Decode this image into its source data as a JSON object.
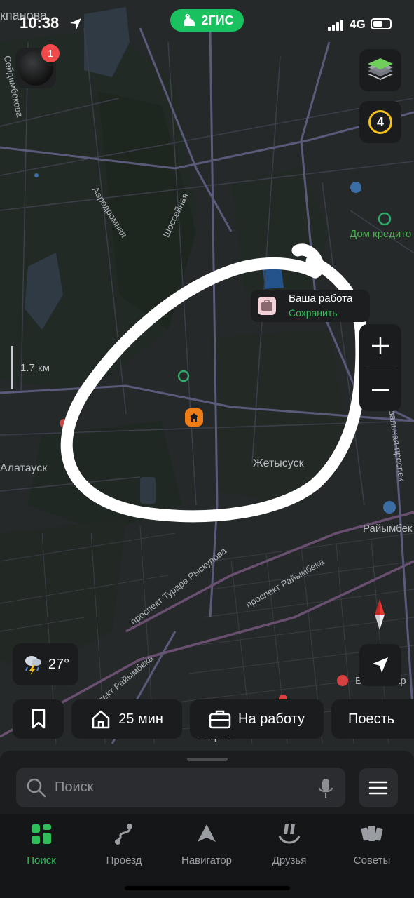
{
  "status": {
    "time": "10:38",
    "network": "4G"
  },
  "brand": {
    "name": "2ГИС"
  },
  "avatar": {
    "badge_count": "1"
  },
  "controls": {
    "traffic_level": "4",
    "zoom_in": "+",
    "zoom_out": "−"
  },
  "scale": {
    "label": "1.7 км"
  },
  "map_labels": {
    "top_partial": "кпанова",
    "seydimbekov": "Сейдимбекова",
    "aerodromnaya": "Аэродромная",
    "shosseynaya": "Шоссейная",
    "dom_kredito": "Дом кредито",
    "alatauskiy": "Алатауск",
    "zhetysuskiy": "Жетысуск",
    "tourara": "проспект Турара Рыскулова",
    "raiymbeka1": "проспект Райымбека",
    "raiymbeka2": "проспект Райымбека",
    "raiymbek_station": "Райымбек",
    "vokzalnaya": "зальная-проспек",
    "sairan": "Сайран",
    "bottom_right": "В",
    "bottom_right2": "ар"
  },
  "callout": {
    "title": "Ваша работа",
    "action": "Сохранить"
  },
  "weather": {
    "temp": "27°"
  },
  "chips": [
    {
      "label": ""
    },
    {
      "label": "25 мин"
    },
    {
      "label": "На работу"
    },
    {
      "label": "Поесть"
    }
  ],
  "search": {
    "placeholder": "Поиск"
  },
  "tabs": [
    {
      "label": "Поиск",
      "icon": "grid-icon"
    },
    {
      "label": "Проезд",
      "icon": "route-icon"
    },
    {
      "label": "Навигатор",
      "icon": "navigator-icon"
    },
    {
      "label": "Друзья",
      "icon": "friends-icon"
    },
    {
      "label": "Советы",
      "icon": "tips-icon"
    }
  ],
  "colors": {
    "accent": "#19c15f",
    "brand": "#19c15f",
    "traffic": "#f4c21b",
    "home_pin": "#ef7d17",
    "badge": "#f24a4a"
  }
}
